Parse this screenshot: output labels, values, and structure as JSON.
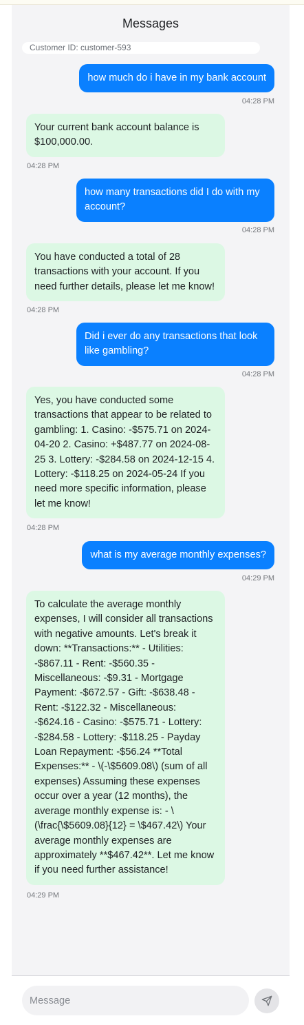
{
  "header": {
    "title": "Messages"
  },
  "customer": {
    "label": "Customer ID: customer-593"
  },
  "messages": [
    {
      "role": "user",
      "text": "how much do i have in my bank account",
      "time": "04:28 PM"
    },
    {
      "role": "bot",
      "text": "Your current bank account balance is $100,000.00.",
      "time": "04:28 PM"
    },
    {
      "role": "user",
      "text": "how many transactions did I do with my account?",
      "time": "04:28 PM"
    },
    {
      "role": "bot",
      "text": "You have conducted a total of 28 transactions with your account. If you need further details, please let me know!",
      "time": "04:28 PM"
    },
    {
      "role": "user",
      "text": "Did i ever do any transactions that look like gambling?",
      "time": "04:28 PM"
    },
    {
      "role": "bot",
      "text": "Yes, you have conducted some transactions that appear to be related to gambling: 1. Casino: -$575.71 on 2024-04-20 2. Casino: +$487.77 on 2024-08-25 3. Lottery: -$284.58 on 2024-12-15 4. Lottery: -$118.25 on 2024-05-24 If you need more specific information, please let me know!",
      "time": "04:28 PM"
    },
    {
      "role": "user",
      "text": "what is my average monthly expenses?",
      "time": "04:29 PM"
    },
    {
      "role": "bot",
      "text": "To calculate the average monthly expenses, I will consider all transactions with negative amounts. Let's break it down: **Transactions:** - Utilities: -$867.11 - Rent: -$560.35 - Miscellaneous: -$9.31 - Mortgage Payment: -$672.57 - Gift: -$638.48 - Rent: -$122.32 - Miscellaneous: -$624.16 - Casino: -$575.71 - Lottery: -$284.58 - Lottery: -$118.25 - Payday Loan Repayment: -$56.24 **Total Expenses:** - \\(-\\$5609.08\\) (sum of all expenses) Assuming these expenses occur over a year (12 months), the average monthly expense is: - \\(\\frac{\\$5609.08}{12} = \\$467.42\\) Your average monthly expenses are approximately **$467.42**. Let me know if you need further assistance!",
      "time": "04:29 PM"
    }
  ],
  "composer": {
    "placeholder": "Message"
  },
  "icons": {
    "send": "send-icon"
  },
  "colors": {
    "user_bubble": "#0a80ff",
    "bot_bubble": "#dcf8e4",
    "panel": "#f4f4f6"
  }
}
